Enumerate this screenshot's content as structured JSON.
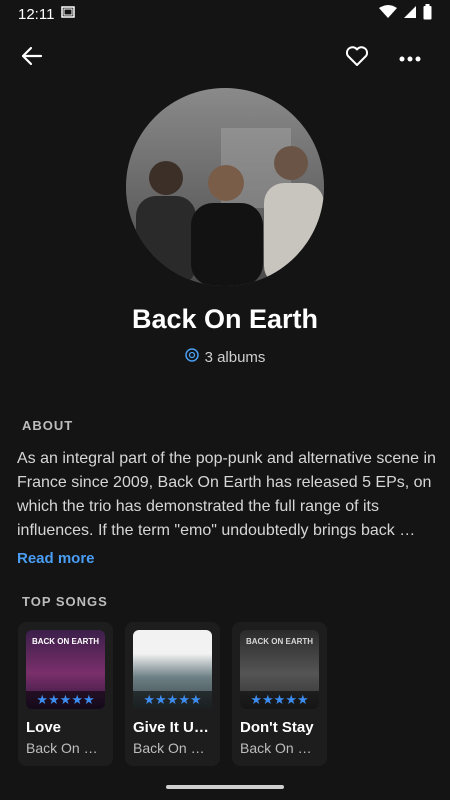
{
  "status": {
    "time": "12:11"
  },
  "artist": {
    "name": "Back On Earth",
    "albums": "3 albums"
  },
  "about": {
    "title": "ABOUT",
    "text": "As an integral part of the pop-punk and alternative scene in France since 2009, Back On Earth has released 5 EPs, on which the trio has demonstrated the full range of its influences. If the term \"emo\" undoubtedly brings back …",
    "read_more": "Read more"
  },
  "top_songs": {
    "title": "TOP SONGS",
    "items": [
      {
        "title": "Love",
        "artist": "Back On E…",
        "cover_text": "BACK ON EARTH",
        "rating": "★★★★★"
      },
      {
        "title": "Give It Up…",
        "artist": "Back On E…",
        "cover_text": "",
        "rating": "★★★★★"
      },
      {
        "title": "Don't Stay",
        "artist": "Back On E…",
        "cover_text": "BACK ON EARTH",
        "rating": "★★★★★"
      }
    ]
  },
  "icons": {
    "back": "arrow-left-icon",
    "favorite": "heart-outline-icon",
    "more": "more-horizontal-icon",
    "albums": "vinyl-disc-icon"
  },
  "colors": {
    "background": "#141414",
    "accent": "#4a9df2",
    "star": "#3d8df0"
  }
}
